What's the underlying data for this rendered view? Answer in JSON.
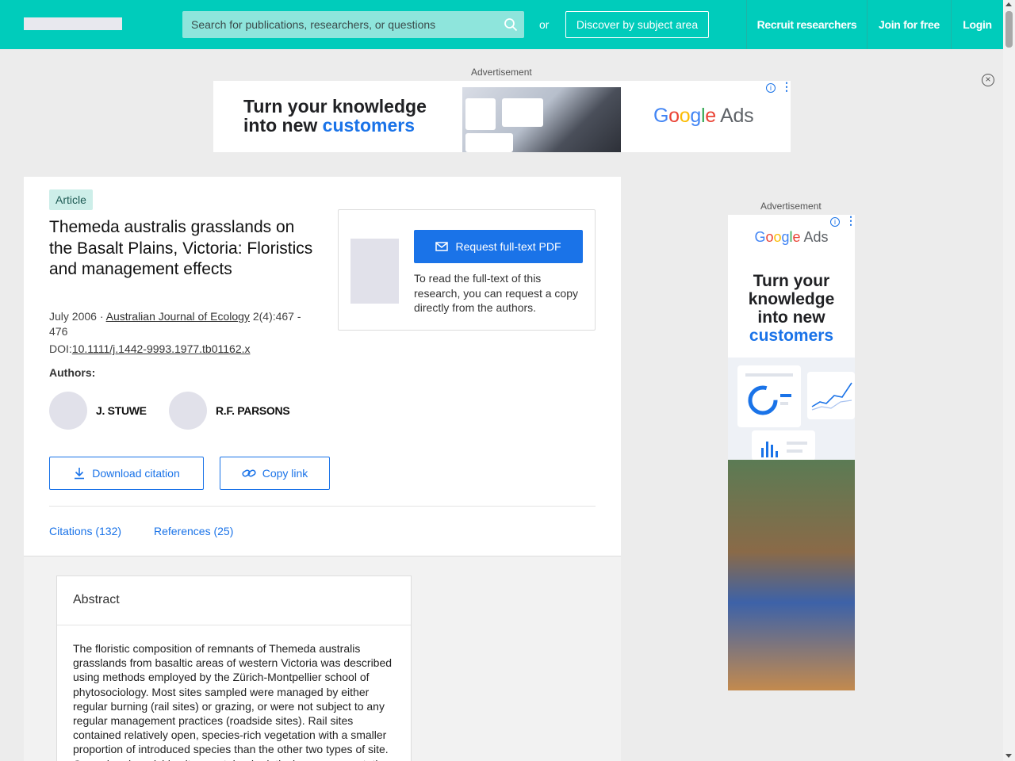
{
  "header": {
    "search_placeholder": "Search for publications, researchers, or questions",
    "or_text": "or",
    "discover_label": "Discover by subject area",
    "recruit_label": "Recruit researchers",
    "join_label": "Join for free",
    "login_label": "Login"
  },
  "ads": {
    "label": "Advertisement",
    "top": {
      "headline_line1": "Turn your knowledge",
      "headline_line2a": "into new ",
      "headline_line2b": "customers",
      "brand_google": [
        "G",
        "o",
        "o",
        "g",
        "l",
        "e"
      ],
      "brand_ads": "Ads"
    },
    "side": {
      "headline_line1": "Turn your",
      "headline_line2": "knowledge",
      "headline_line3": "into new",
      "headline_line4": "customers",
      "brand_ads": "Ads"
    },
    "info_glyph": "i",
    "close_glyph": "×"
  },
  "article": {
    "type_badge": "Article",
    "title": "Themeda australis grasslands on the Basalt Plains, Victoria: Floristics and management effects",
    "date": "July 2006",
    "journal": "Australian Journal of Ecology",
    "volume_pages": "2(4):467 - 476",
    "doi_prefix": "DOI:",
    "doi": "10.1111/j.1442-9993.1977.tb01162.x",
    "authors_label": "Authors:",
    "authors": [
      "J. STUWE",
      "R.F. PARSONS"
    ],
    "download_citation": "Download citation",
    "copy_link": "Copy link",
    "tabs": [
      "Citations (132)",
      "References (25)"
    ]
  },
  "pdf": {
    "request_label": "Request full-text PDF",
    "note": "To read the full-text of this research, you can request a copy directly from the authors."
  },
  "abstract": {
    "heading": "Abstract",
    "text": "The floristic composition of remnants of Themeda australis grasslands from basaltic areas of western Victoria was described using methods employed by the Zürich-Montpellier school of phytosociology. Most sites sampled were managed by either regular burning (rail sites) or grazing, or were not subject to any regular management practices (roadside sites). Rail sites contained relatively open, species-rich vegetation with a smaller proportion of introduced species than the other two types of site. Grazed and roadside sites contained relatively poorer vegetation."
  },
  "colors": {
    "header_bg": "#00ccbb",
    "accent": "#1a73e8",
    "badge_bg": "#cdeee9"
  }
}
